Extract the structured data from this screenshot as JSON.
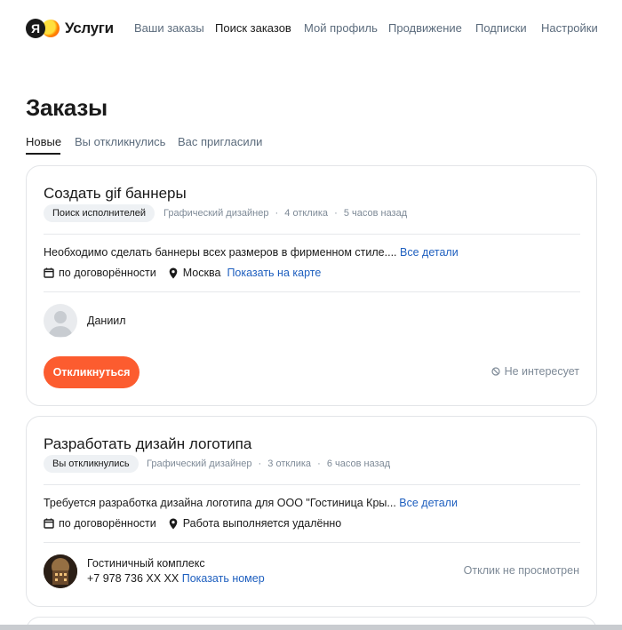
{
  "header": {
    "logo_text": "Услуги",
    "nav": [
      "Ваши заказы",
      "Поиск заказов",
      "Мой профиль",
      "Продвижение",
      "Подписки",
      "Настройки"
    ]
  },
  "page": {
    "title": "Заказы",
    "tabs": [
      "Новые",
      "Вы откликнулись",
      "Вас пригласили"
    ]
  },
  "orders": [
    {
      "title": "Создать gif баннеры",
      "status": "Поиск исполнителей",
      "category": "Графический дизайнер",
      "responses": "4 отклика",
      "time": "5 часов назад",
      "description": "Необходимо сделать баннеры всех размеров в фирменном стиле....",
      "details_link": "Все детали",
      "price": "по договорённости",
      "location": "Москва",
      "map_link": "Показать на карте",
      "client_name": "Даниил",
      "respond_label": "Откликнуться",
      "not_interested_label": "Не интересует"
    },
    {
      "title": "Разработать дизайн логотипа",
      "status": "Вы откликнулись",
      "category": "Графический дизайнер",
      "responses": "3 отклика",
      "time": "6 часов назад",
      "description": "Требуется разработка дизайна логотипа для ООО \"Гостиница Кры...",
      "details_link": "Все детали",
      "price": "по договорённости",
      "location": "Работа выполняется удалённо",
      "client_name": "Гостиничный комплекс",
      "client_phone": "+7 978 736 XX XX",
      "phone_link": "Показать номер",
      "response_status": "Отклик не просмотрен"
    }
  ],
  "icons": {
    "calendar": "calendar-icon",
    "location": "location-pin-icon",
    "not_interested": "ban-icon"
  },
  "colors": {
    "accent": "#fc5c2f",
    "link": "#1e5fbf",
    "muted": "#7e8a97",
    "chip_bg": "#eef1f4"
  }
}
